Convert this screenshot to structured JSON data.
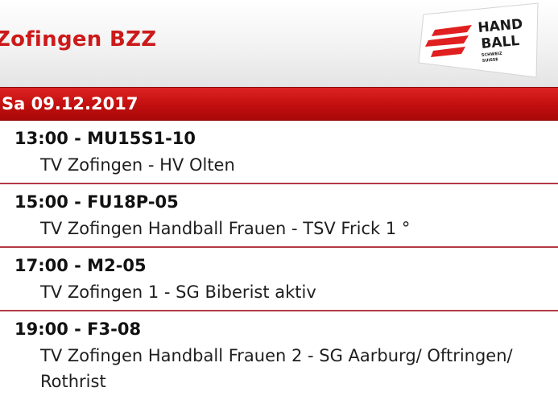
{
  "header": {
    "title": "Zofingen BZZ",
    "logo": {
      "icon": "handball-logo-icon",
      "line1": "HAND",
      "line2": "BALL",
      "sub1": "SCHWEIZ",
      "sub2": "SUISSE"
    }
  },
  "date_bar": {
    "label": "Sa 09.12.2017"
  },
  "matches": [
    {
      "head": "13:00 - MU15S1-10",
      "teams": "TV Zofingen - HV Olten"
    },
    {
      "head": "15:00 - FU18P-05",
      "teams": "TV Zofingen Handball Frauen - TSV Frick 1 °"
    },
    {
      "head": "17:00 - M2-05",
      "teams": "TV Zofingen 1 - SG Biberist aktiv"
    },
    {
      "head": "19:00 - F3-08",
      "teams": "TV Zofingen Handball Frauen 2 - SG Aarburg/ Oftringen/ Rothrist"
    }
  ],
  "colors": {
    "brand_red": "#cc1a1a",
    "separator": "#b33a46"
  }
}
